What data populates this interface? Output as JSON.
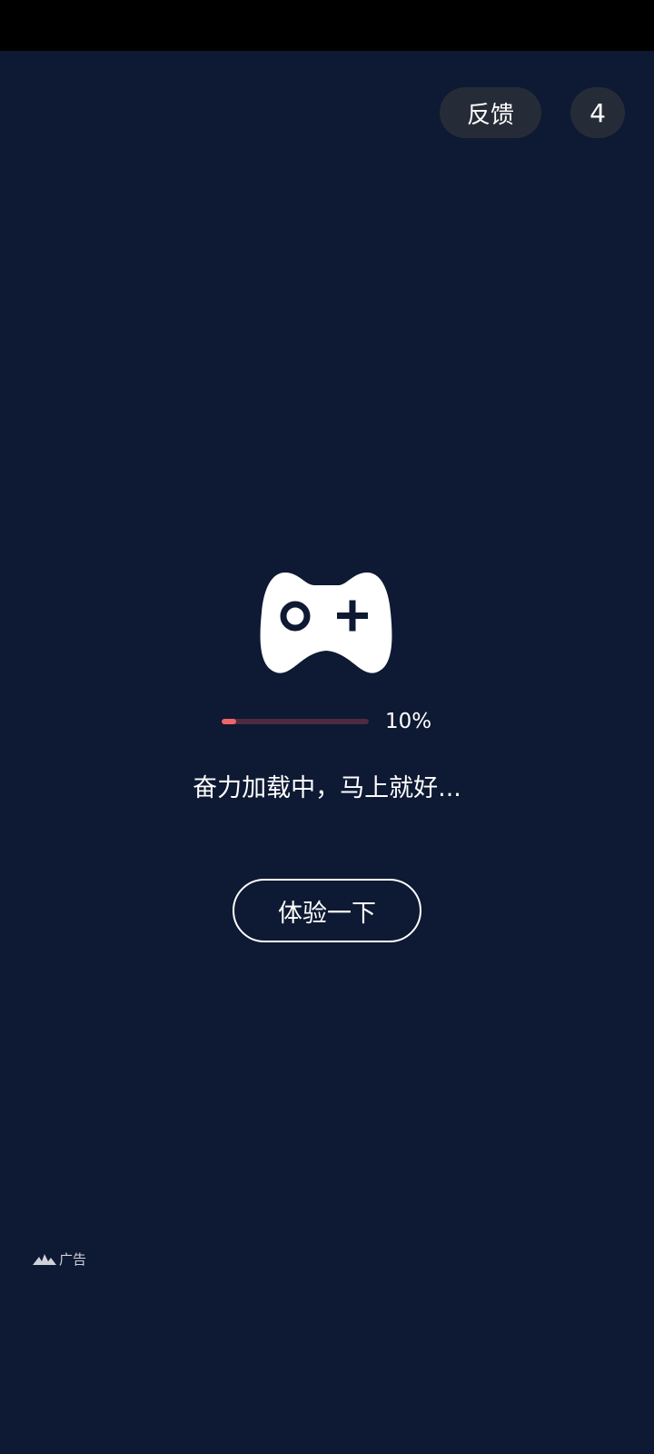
{
  "header": {
    "feedback_label": "反馈",
    "countdown": "4"
  },
  "loader": {
    "icon": "gamepad-icon",
    "progress_fraction": 0.1,
    "progress_text": "10%",
    "message": "奋力加载中，马上就好..."
  },
  "actions": {
    "try_label": "体验一下"
  },
  "footer": {
    "ad_icon": "ad-network-logo-icon",
    "ad_label": "广告"
  },
  "colors": {
    "background": "#0e1933",
    "progress_fill": "#f0646a",
    "progress_track": "#4d2b40",
    "pill_background": "#262c37"
  }
}
